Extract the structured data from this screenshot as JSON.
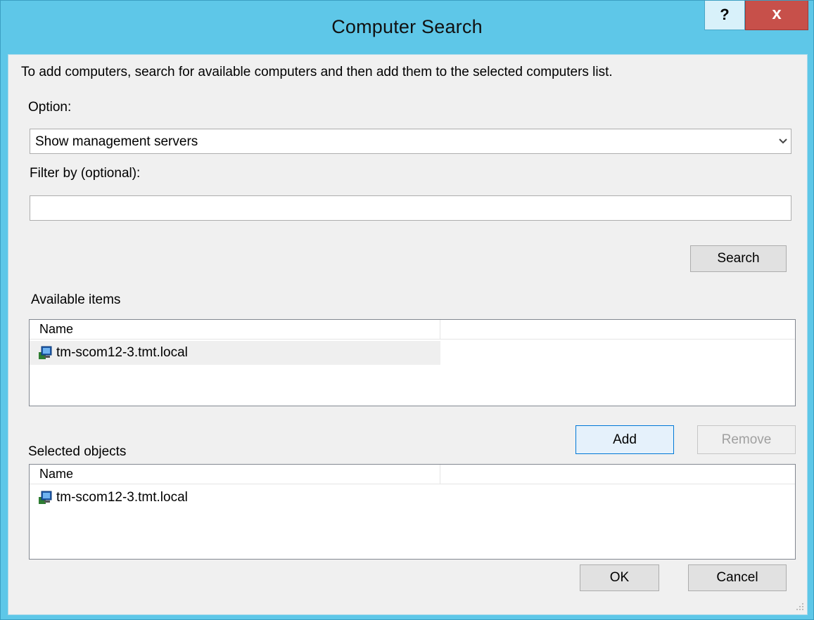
{
  "window": {
    "title": "Computer Search",
    "help_label": "?",
    "close_label": "x"
  },
  "instructions": "To add computers, search for available computers and then add them to the selected computers list.",
  "option": {
    "label": "Option:",
    "selected": "Show management servers"
  },
  "filter": {
    "label": "Filter by (optional):",
    "value": ""
  },
  "buttons": {
    "search": "Search",
    "add": "Add",
    "remove": "Remove",
    "ok": "OK",
    "cancel": "Cancel"
  },
  "available": {
    "label": "Available items",
    "column": "Name",
    "items": [
      "tm-scom12-3.tmt.local"
    ]
  },
  "selected": {
    "label": "Selected objects",
    "column": "Name",
    "items": [
      "tm-scom12-3.tmt.local"
    ]
  },
  "icons": {
    "computer": "computer-icon",
    "dropdown": "chevron-down-icon",
    "grip": "resize-grip-icon"
  }
}
